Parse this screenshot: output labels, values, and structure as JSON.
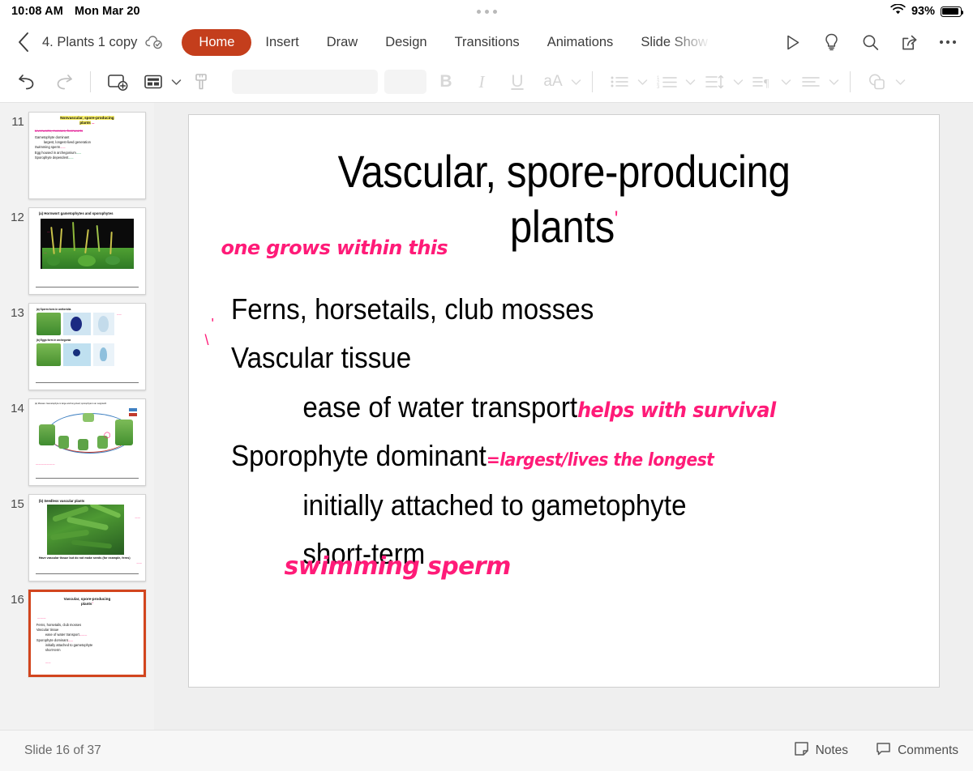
{
  "status_bar": {
    "time": "10:08 AM",
    "date": "Mon Mar 20",
    "battery_percent": "93%",
    "wifi_icon": "wifi-icon",
    "battery_icon": "battery-icon"
  },
  "header": {
    "back_icon": "back-chevron-icon",
    "document_title": "4. Plants 1 copy",
    "sync_icon": "cloud-check-icon",
    "tabs": [
      {
        "label": "Home",
        "active": true
      },
      {
        "label": "Insert",
        "active": false
      },
      {
        "label": "Draw",
        "active": false
      },
      {
        "label": "Design",
        "active": false
      },
      {
        "label": "Transitions",
        "active": false
      },
      {
        "label": "Animations",
        "active": false
      },
      {
        "label": "Slide Show",
        "active": false
      }
    ],
    "icons": [
      "play-icon",
      "lightbulb-icon",
      "search-icon",
      "share-icon",
      "more-options-icon"
    ],
    "accent_color": "#c43e1c"
  },
  "toolbar": {
    "undo_label": "Undo",
    "redo_label": "Redo",
    "new_slide_label": "New Slide",
    "layout_label": "Layout",
    "format_painter_label": "Format Painter",
    "font_name_value": "",
    "font_size_value": "",
    "bold_label": "B",
    "italic_label": "I",
    "underline_label": "U",
    "font_format_label": "aA",
    "bullets_label": "Bullets",
    "numbering_label": "Numbering",
    "line_spacing_label": "Line Spacing",
    "text_direction_label": "Text Direction",
    "align_label": "Align",
    "shapes_label": "Shapes"
  },
  "thumbnails": [
    {
      "number": "11",
      "title_plain": "Nonvascular, spore-producing",
      "title_highlight": "Nonvascular, spore-producing",
      "title_line2": "plants",
      "subtitle_struck": "Liverworts, mosses, hornworts",
      "lines": [
        "Gametophyte dominant",
        "largest, longest-lived generation",
        "Swimming sperm",
        "Egg housed in archegonium",
        "Sporophyte dependent"
      ],
      "selected": false
    },
    {
      "number": "12",
      "caption": "(a) Hornwort gametophytes and sporophytes",
      "selected": false
    },
    {
      "number": "13",
      "caption_a": "(a) Sperm form in antheridia",
      "caption_b": "(b) Eggs form in archegonia",
      "selected": false
    },
    {
      "number": "14",
      "caption": "(a) Mosses: Gametophyte is large and long-lived; sporophyte is an outgrowth",
      "selected": false
    },
    {
      "number": "15",
      "caption": "(b) Seedless vascular plants",
      "footer_text": "Have vascular tissue but do not make seeds (for example, ferns)",
      "selected": false
    },
    {
      "number": "16",
      "title_line1": "Vascular, spore-producing",
      "title_line2": "plants",
      "lines": [
        "Ferns, horsetails, club mosses",
        "Vascular tissue",
        "ease of water transport",
        "Sporophyte dominant",
        "initially attached to gametophyte",
        "short-term"
      ],
      "selected": true
    }
  ],
  "slide": {
    "title_line1": "Vascular, spore-producing",
    "title_line2": "plants",
    "title_ink_tick": "'",
    "bullets": [
      {
        "text": "Ferns, horsetails, club mosses",
        "level": 1
      },
      {
        "text": "Vascular tissue",
        "level": 1
      },
      {
        "text": "ease of water transport",
        "level": 2
      },
      {
        "text": "Sporophyte dominant",
        "level": 1
      },
      {
        "text": "initially attached to gametophyte",
        "level": 2
      },
      {
        "text": "short-term",
        "level": 2
      }
    ],
    "annotations": [
      {
        "name": "annotation-one-grows-within-this",
        "text": "one grows within this"
      },
      {
        "name": "annotation-helps-with-survival",
        "text": "helps with survival"
      },
      {
        "name": "annotation-largest-lives-longest",
        "text": "=largest/lives the longest"
      },
      {
        "name": "annotation-swimming-sperm",
        "text": "swimming sperm"
      }
    ],
    "ink_color": "#ff1b78"
  },
  "footer": {
    "slide_counter": "Slide 16 of 37",
    "notes_label": "Notes",
    "comments_label": "Comments",
    "notes_icon": "note-icon",
    "comments_icon": "comment-bubble-icon"
  }
}
